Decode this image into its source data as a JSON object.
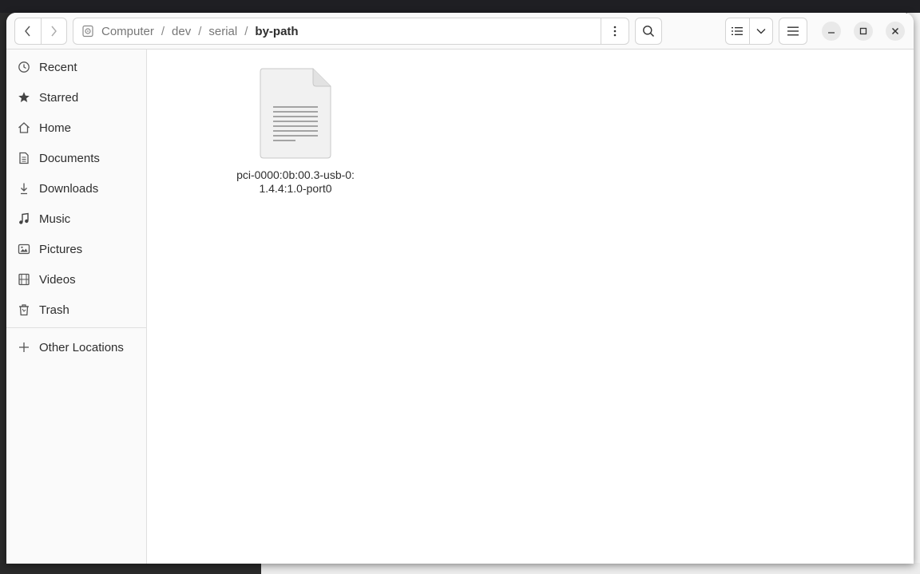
{
  "window": {
    "navigation": {
      "back_icon": "chevron-left-icon",
      "forward_icon": "chevron-right-icon"
    },
    "pathbar": {
      "location_icon": "drive-icon",
      "crumbs": [
        "Computer",
        "dev",
        "serial",
        "by-path"
      ],
      "separator": "/",
      "menu_icon": "vertical-dots-icon"
    },
    "toolbar": {
      "search_icon": "search-icon",
      "view_list_icon": "list-view-icon",
      "view_options_icon": "chevron-down-icon",
      "main_menu_icon": "hamburger-menu-icon"
    },
    "window_controls": [
      "minimize-icon",
      "maximize-icon",
      "close-icon"
    ]
  },
  "sidebar": {
    "items": [
      {
        "label": "Recent",
        "icon": "clock-icon"
      },
      {
        "label": "Starred",
        "icon": "star-icon"
      },
      {
        "label": "Home",
        "icon": "home-icon"
      },
      {
        "label": "Documents",
        "icon": "document-icon"
      },
      {
        "label": "Downloads",
        "icon": "download-icon"
      },
      {
        "label": "Music",
        "icon": "music-note-icon"
      },
      {
        "label": "Pictures",
        "icon": "picture-icon"
      },
      {
        "label": "Videos",
        "icon": "film-icon"
      },
      {
        "label": "Trash",
        "icon": "trash-icon"
      }
    ],
    "other_locations": {
      "label": "Other Locations",
      "icon": "plus-icon"
    }
  },
  "content": {
    "files": [
      {
        "name": "pci-0000:0b:00.3-usb-0:1.4.4:1.0-port0",
        "icon": "text-file-icon"
      }
    ]
  },
  "colors": {
    "window_bg": "#ffffff",
    "sidebar_bg": "#fafafa",
    "headerbar_bg": "#fafafa",
    "text": "#2e2e2e"
  }
}
